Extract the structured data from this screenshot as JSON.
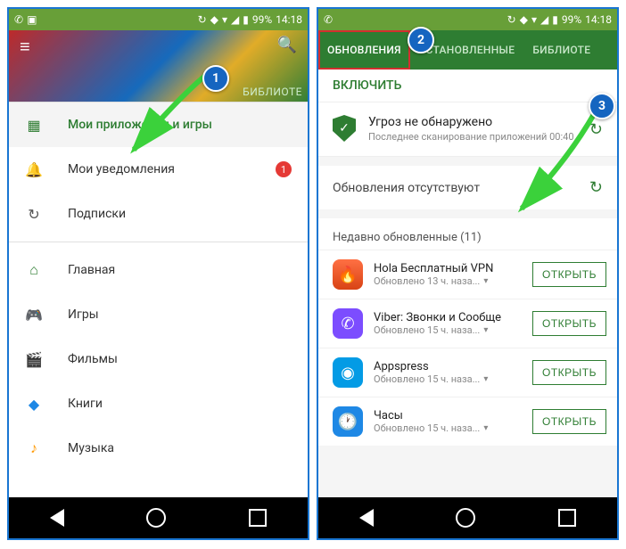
{
  "status": {
    "battery": "99%",
    "time": "14:18"
  },
  "phone1": {
    "tab_peek": "БИБЛИОТЕ",
    "drawer": {
      "my_apps": "Мои приложения и игры",
      "notifications": "Мои уведомления",
      "notif_badge": "1",
      "subs": "Подписки",
      "home": "Главная",
      "games": "Игры",
      "films": "Фильмы",
      "books": "Книги",
      "music": "Музыка"
    }
  },
  "phone2": {
    "tabs": {
      "updates": "ОБНОВЛЕНИЯ",
      "installed": "УСТАНОВЛЕННЫЕ",
      "library": "БИБЛИОТЕ"
    },
    "enable": "ВКЛЮЧИТЬ",
    "protect": {
      "title": "Угроз не обнаружено",
      "sub": "Последнее сканирование приложений 00:40"
    },
    "no_updates": "Обновления отсутствуют",
    "recent_header": "Недавно обновленные (11)",
    "open_label": "ОТКРЫТЬ",
    "apps": [
      {
        "name": "Hola Бесплатный VPN",
        "sub": "Обновлено 13 ч. наза..."
      },
      {
        "name": "Viber: Звонки и Сообще",
        "sub": "Обновлено 15 ч. наза..."
      },
      {
        "name": "Appspress",
        "sub": "Обновлено 15 ч. наза..."
      },
      {
        "name": "Часы",
        "sub": "Обновлено 15 ч. наза..."
      }
    ]
  },
  "markers": {
    "m1": "1",
    "m2": "2",
    "m3": "3"
  }
}
